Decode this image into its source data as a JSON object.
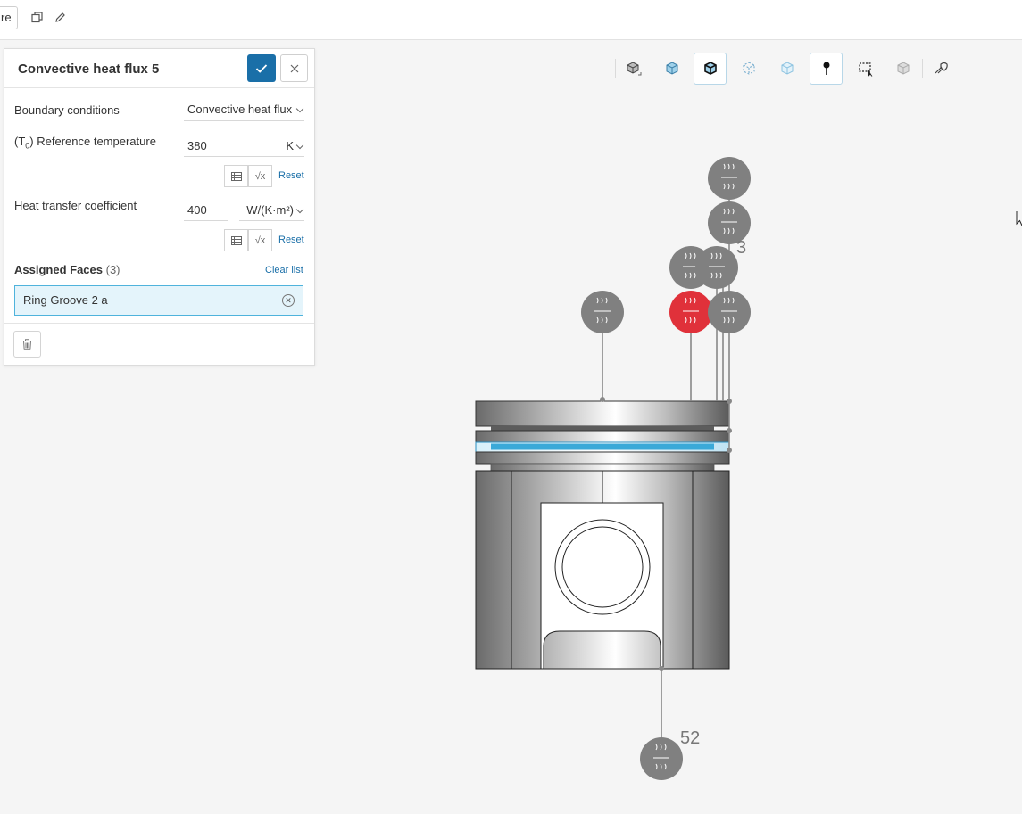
{
  "topbar": {
    "cut_button_label": "re",
    "duplicate_icon": "duplicate-icon",
    "edit_icon": "pencil-icon"
  },
  "panel": {
    "title": "Convective heat flux 5",
    "boundary_conditions": {
      "label": "Boundary conditions",
      "value": "Convective heat flux"
    },
    "reference_temperature": {
      "label_prefix": "(T",
      "label_sub": "0",
      "label_suffix": ") Reference temperature",
      "value": "380",
      "unit": "K",
      "reset_label": "Reset"
    },
    "heat_transfer_coefficient": {
      "label": "Heat transfer coefficient",
      "value": "400",
      "unit": "W/(K·m²)",
      "reset_label": "Reset"
    },
    "assigned_faces": {
      "label": "Assigned Faces",
      "count": "(3)",
      "clear_label": "Clear list",
      "items": [
        "Ring Groove 2 a"
      ]
    }
  },
  "viewport": {
    "marker_labels": [
      "3",
      "52"
    ],
    "colors": {
      "marker_gray": "#808080",
      "marker_selected": "#e0313a",
      "highlight_face": "#3aa9d8",
      "accent": "#1a6fa8"
    }
  }
}
